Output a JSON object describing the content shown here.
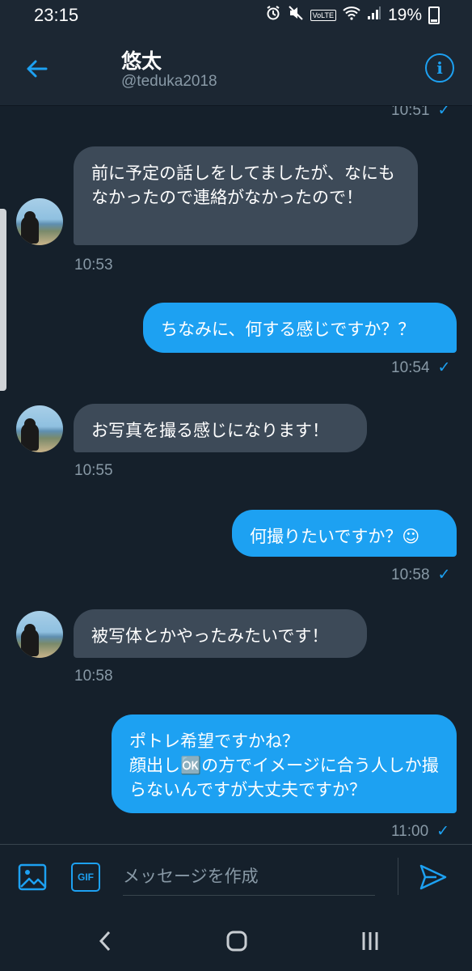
{
  "status_bar": {
    "time": "23:15",
    "volte": "VoLTE",
    "battery": "19%"
  },
  "header": {
    "name": "悠太",
    "handle": "@teduka2018"
  },
  "messages": [
    {
      "dir": "out",
      "text": "",
      "time": "10:51",
      "read": true
    },
    {
      "dir": "in",
      "text": "前に予定の話しをしてましたが、なにもなかったので連絡がなかったので！",
      "time": "10:53"
    },
    {
      "dir": "out",
      "text": "ちなみに、何する感じですか？？",
      "time": "10:54",
      "read": true
    },
    {
      "dir": "in",
      "text": "お写真を撮る感じになります！",
      "time": "10:55"
    },
    {
      "dir": "out",
      "text": "何撮りたいですか？☺",
      "time": "10:58",
      "read": true
    },
    {
      "dir": "in",
      "text": "被写体とかやったみたいです！",
      "time": "10:58"
    },
    {
      "dir": "out",
      "text": "ポトレ希望ですかね？\n顔出し🆗の方でイメージに合う人しか撮らないんですが大丈夫ですか？",
      "time": "11:00",
      "read": true
    }
  ],
  "composer": {
    "gif_label": "GIF",
    "placeholder": "メッセージを作成"
  },
  "colors": {
    "background": "#15202b",
    "accent": "#1da1f2",
    "incoming_bubble": "#3d4a58",
    "muted_text": "#8899a6"
  },
  "icons": {
    "back": "arrow-left-icon",
    "info": "info-icon",
    "image": "image-icon",
    "send": "send-icon",
    "check": "checkmark-icon"
  }
}
